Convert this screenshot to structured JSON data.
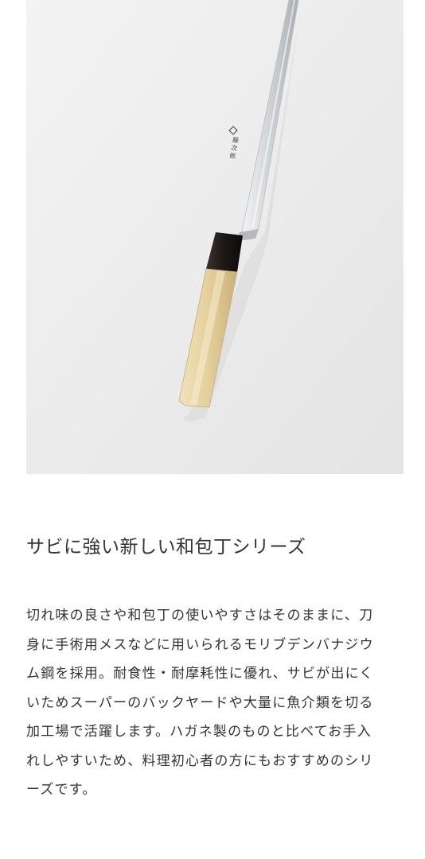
{
  "product": {
    "image_alt": "柳刃包丁",
    "blade_inscription": "藤次郎",
    "heading": "サビに強い新しい和包丁シリーズ",
    "description_lines": [
      "切れ味の良さや和包丁の使いやすさはそのままに、刀",
      "身に手術用メスなどに用いられるモリブデンバナジウ",
      "ム鋼を採用。耐食性・耐摩耗性に優れ、サビが出にく",
      "いためスーパーのバックヤードや大量に魚介類を切る",
      "加工場で活躍します。ハガネ製のものと比べてお手入",
      "れしやすいため、料理初心者の方にもおすすめのシリ",
      "ーズです。"
    ]
  },
  "colors": {
    "background": "#ececec",
    "text": "#333333",
    "blade": "#c9ccd0",
    "handle_wood": "#e3cf9f",
    "ferrule": "#1c1716"
  }
}
